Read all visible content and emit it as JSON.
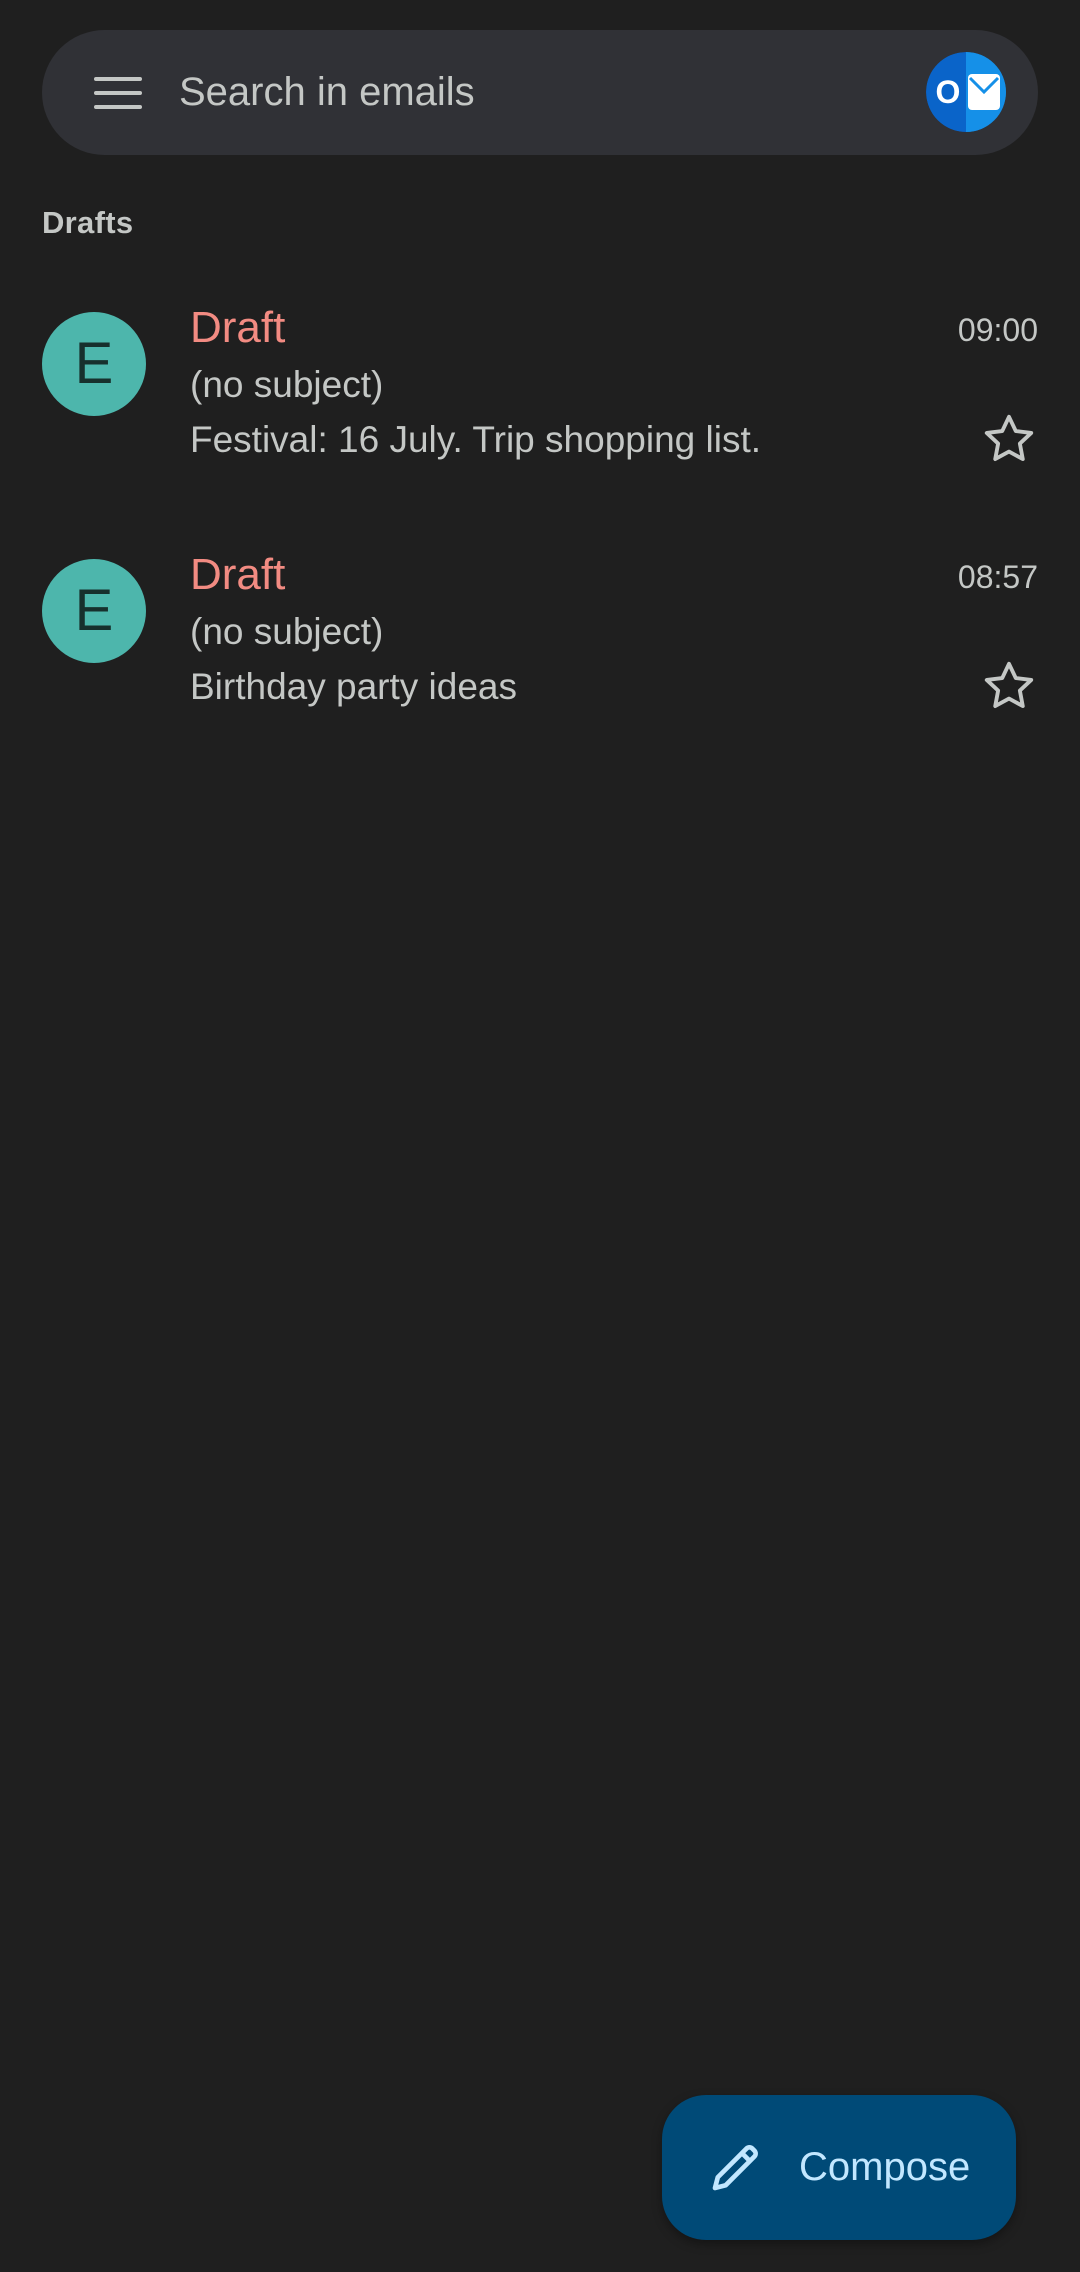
{
  "search": {
    "placeholder": "Search in emails"
  },
  "account": {
    "badge_text": "O",
    "brand_color": "#0a64c9"
  },
  "section": {
    "title": "Drafts"
  },
  "emails": [
    {
      "avatar_letter": "E",
      "sender": "Draft",
      "time": "09:00",
      "subject": "(no subject)",
      "snippet": "Festival: 16 July. Trip shopping list.",
      "starred": false
    },
    {
      "avatar_letter": "E",
      "sender": "Draft",
      "time": "08:57",
      "subject": "(no subject)",
      "snippet": "Birthday party ideas",
      "starred": false
    }
  ],
  "compose": {
    "label": "Compose"
  },
  "colors": {
    "background": "#1f1f1f",
    "search_bar": "#303136",
    "avatar": "#4db6ac",
    "draft_label": "#f28b82",
    "compose_bg": "#004a77",
    "compose_text": "#c2e7ff"
  }
}
